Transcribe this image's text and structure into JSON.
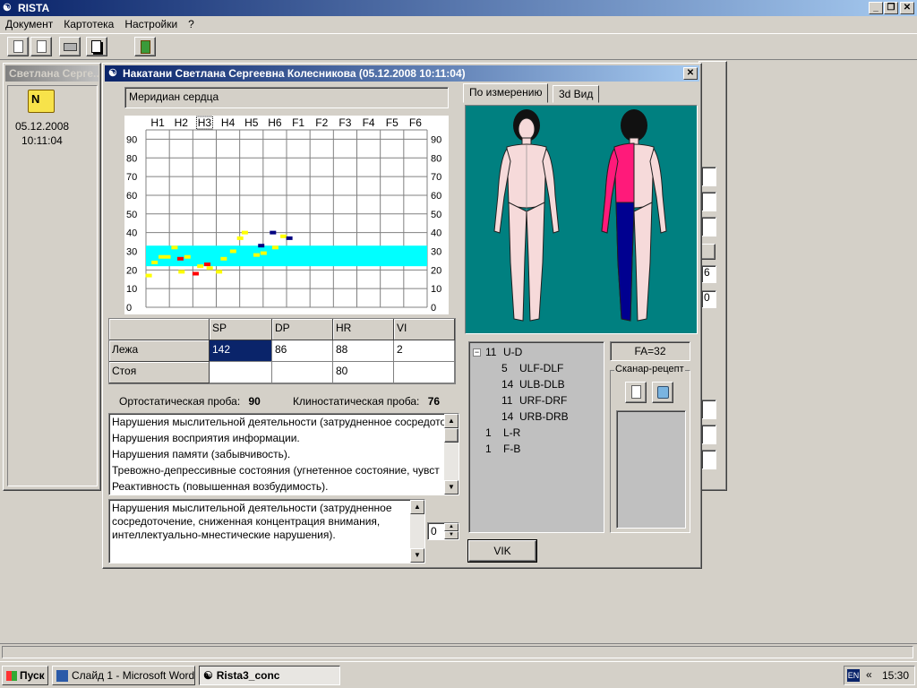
{
  "app": {
    "title": "RISTA",
    "menu": [
      "Документ",
      "Картотека",
      "Настройки",
      "?"
    ]
  },
  "left_panel": {
    "title": "Светлана Серге...",
    "icon_label": "N",
    "date": "05.12.2008",
    "time": "10:11:04"
  },
  "dialog": {
    "title": "Накатани Светлана Сергеевна Колесникова (05.12.2008 10:11:04)",
    "meridian_label": "Меридиан сердца",
    "chart_data": {
      "type": "scatter",
      "categories": [
        "H1",
        "H2",
        "H3",
        "H4",
        "H5",
        "H6",
        "F1",
        "F2",
        "F3",
        "F4",
        "F5",
        "F6"
      ],
      "selected_category": "H3",
      "yticks": [
        90,
        80,
        70,
        60,
        50,
        40,
        30,
        20,
        10,
        0
      ],
      "ylim": [
        0,
        95
      ],
      "norm_band": [
        22,
        33
      ],
      "grid": true,
      "series": [
        {
          "color": "#ffff00",
          "points": [
            [
              0.1,
              17
            ],
            [
              0.35,
              24
            ],
            [
              0.65,
              27
            ],
            [
              0.9,
              27
            ],
            [
              1.2,
              32
            ],
            [
              1.5,
              19
            ],
            [
              1.75,
              27
            ],
            [
              2.3,
              22
            ],
            [
              2.7,
              21
            ],
            [
              3.1,
              19
            ],
            [
              3.3,
              26
            ],
            [
              3.7,
              30
            ],
            [
              4.0,
              37
            ],
            [
              4.2,
              40
            ],
            [
              4.7,
              28
            ],
            [
              5.0,
              29
            ],
            [
              5.5,
              32
            ],
            [
              5.85,
              38
            ]
          ]
        },
        {
          "color": "#ff0000",
          "points": [
            [
              1.45,
              26
            ],
            [
              2.1,
              18
            ],
            [
              2.6,
              23
            ]
          ]
        },
        {
          "color": "#000080",
          "points": [
            [
              4.9,
              33
            ],
            [
              5.4,
              40
            ],
            [
              6.1,
              37
            ]
          ]
        }
      ]
    },
    "table": {
      "columns": [
        "",
        "SP",
        "DP",
        "HR",
        "VI"
      ],
      "rows": [
        {
          "label": "Лежа",
          "cells": [
            "142",
            "86",
            "88",
            "2"
          ]
        },
        {
          "label": "Стоя",
          "cells": [
            "",
            "",
            "80",
            ""
          ]
        }
      ]
    },
    "ortho_label": "Ортостатическая проба:",
    "ortho_value": "90",
    "clino_label": "Клиностатическая проба:",
    "clino_value": "76",
    "findings": [
      "Нарушения мыслительной деятельности (затрудненное сосредото",
      "Нарушения восприятия информации.",
      "Нарушения памяти (забывчивость).",
      "Тревожно-депрессивные состояния (угнетенное состояние, чувст",
      "Реактивность (повышенная возбудимость)."
    ],
    "detail_text": "Нарушения мыслительной деятельности (затрудненное сосредоточение, сниженная концентрация внимания, интеллектуально-мнестические нарушения).",
    "spinner_value": "0",
    "tabs": [
      "По измерению",
      "3d Вид"
    ],
    "tree": [
      {
        "indent": 0,
        "toggle": "−",
        "num": "11",
        "label": "U-D"
      },
      {
        "indent": 1,
        "toggle": "",
        "num": "5",
        "label": "ULF-DLF"
      },
      {
        "indent": 1,
        "toggle": "",
        "num": "14",
        "label": "ULB-DLB"
      },
      {
        "indent": 1,
        "toggle": "",
        "num": "11",
        "label": "URF-DRF"
      },
      {
        "indent": 1,
        "toggle": "",
        "num": "14",
        "label": "URB-DRB"
      },
      {
        "indent": 0,
        "toggle": "",
        "num": "1",
        "label": "L-R"
      },
      {
        "indent": 0,
        "toggle": "",
        "num": "1",
        "label": "F-B"
      }
    ],
    "fa_label": "FA=32",
    "scanner_label": "Сканар-рецепт",
    "vik_button": "VIK"
  },
  "bg_right": {
    "field_a": "6",
    "field_b": "0"
  },
  "taskbar": {
    "start": "Пуск",
    "tasks": [
      "Слайд 1 - Microsoft Word",
      "Rista3_conc"
    ],
    "lang": "EN",
    "clock": "15:30"
  },
  "colors": {
    "title_active": "#0a246a",
    "figure_bg": "#008080",
    "norm_band": "#00ffff",
    "table_selected": "#0a246a",
    "body_pink": "#ff1a7a",
    "body_navy": "#000090"
  }
}
